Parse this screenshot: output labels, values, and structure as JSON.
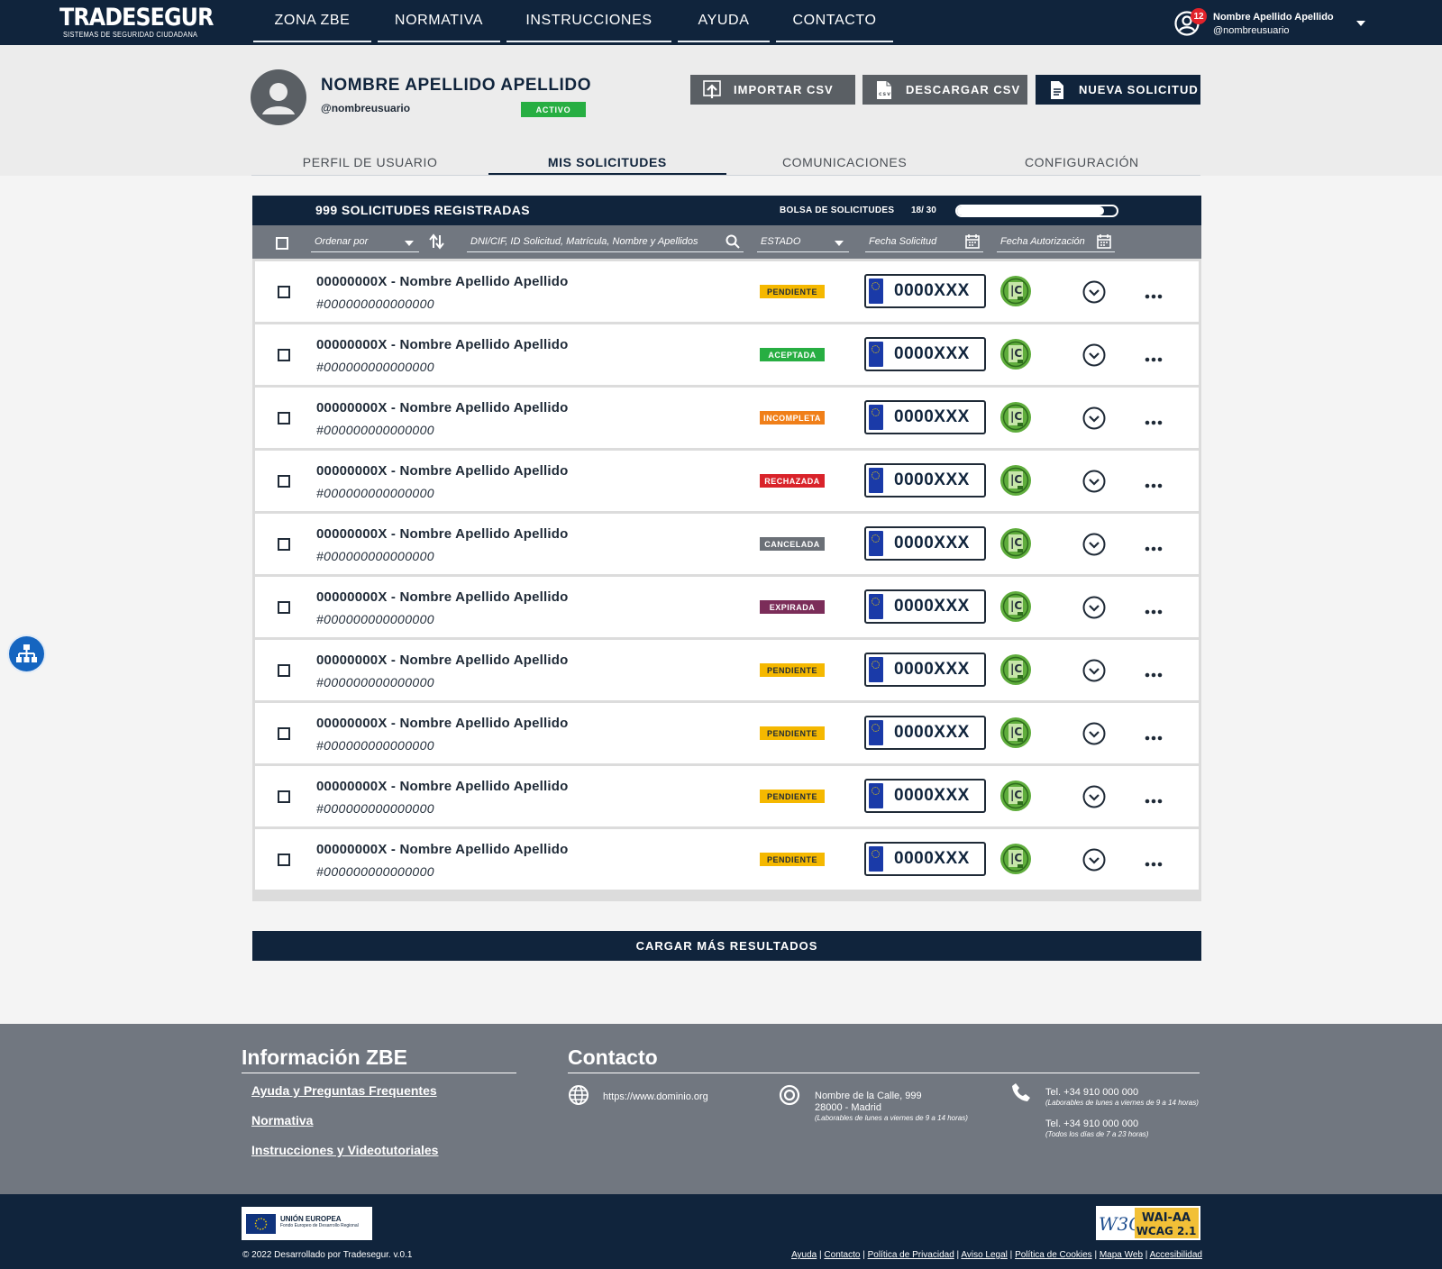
{
  "brand": {
    "name": "TRADESEGUR",
    "tagline": "SISTEMAS DE SEGURIDAD CIUDADANA"
  },
  "nav": {
    "items": [
      {
        "label": "ZONA ZBE",
        "width": 131
      },
      {
        "label": "NORMATIVA",
        "width": 136
      },
      {
        "label": "INSTRUCCIONES",
        "width": 183
      },
      {
        "label": "AYUDA",
        "width": 102
      },
      {
        "label": "CONTACTO",
        "width": 130
      }
    ]
  },
  "user": {
    "name": "Nombre Apellido Apellido",
    "handle": "@nombreusuario",
    "notifications": "12"
  },
  "profile": {
    "name": "NOMBRE APELLIDO APELLIDO",
    "handle": "@nombreusuario",
    "status": "ACTIVO",
    "buttons": {
      "import": "IMPORTAR CSV",
      "download": "DESCARGAR CSV",
      "new": "NUEVA SOLICITUD"
    }
  },
  "tabs": [
    {
      "label": "PERFIL DE USUARIO",
      "active": false
    },
    {
      "label": "MIS SOLICITUDES",
      "active": true
    },
    {
      "label": "COMUNICACIONES",
      "active": false
    },
    {
      "label": "CONFIGURACIÓN",
      "active": false
    }
  ],
  "list": {
    "count": "999 SOLICITUDES REGISTRADAS",
    "bolsa_label": "BOLSA DE SOLICITUDES",
    "bolsa_value": "18/ 30",
    "bolsa_progress": 0.92
  },
  "filters": {
    "order_placeholder": "Ordenar por",
    "search_placeholder": "DNI/CIF, ID Solicitud, Matrícula, Nombre y Apellidos",
    "estado": "ESTADO",
    "fecha_solicitud": "Fecha Solicitud",
    "fecha_autorizacion": "Fecha Autorización"
  },
  "status_colors": {
    "PENDIENTE": {
      "bg": "#f5b800",
      "fg": "#1f2a37"
    },
    "ACEPTADA": {
      "bg": "#27ae42",
      "fg": "#ffffff"
    },
    "INCOMPLETA": {
      "bg": "#f07f19",
      "fg": "#ffffff"
    },
    "RECHAZADA": {
      "bg": "#d9232a",
      "fg": "#ffffff"
    },
    "CANCELADA": {
      "bg": "#6b7077",
      "fg": "#ffffff"
    },
    "EXPIRADA": {
      "bg": "#7b2d59",
      "fg": "#ffffff"
    }
  },
  "rows": [
    {
      "title": "00000000X - Nombre Apellido Apellido",
      "id": "#000000000000000",
      "status": "PENDIENTE",
      "plate": "0000XXX"
    },
    {
      "title": "00000000X - Nombre Apellido Apellido",
      "id": "#000000000000000",
      "status": "ACEPTADA",
      "plate": "0000XXX"
    },
    {
      "title": "00000000X - Nombre Apellido Apellido",
      "id": "#000000000000000",
      "status": "INCOMPLETA",
      "plate": "0000XXX"
    },
    {
      "title": "00000000X - Nombre Apellido Apellido",
      "id": "#000000000000000",
      "status": "RECHAZADA",
      "plate": "0000XXX"
    },
    {
      "title": "00000000X - Nombre Apellido Apellido",
      "id": "#000000000000000",
      "status": "CANCELADA",
      "plate": "0000XXX"
    },
    {
      "title": "00000000X - Nombre Apellido Apellido",
      "id": "#000000000000000",
      "status": "EXPIRADA",
      "plate": "0000XXX"
    },
    {
      "title": "00000000X - Nombre Apellido Apellido",
      "id": "#000000000000000",
      "status": "PENDIENTE",
      "plate": "0000XXX"
    },
    {
      "title": "00000000X - Nombre Apellido Apellido",
      "id": "#000000000000000",
      "status": "PENDIENTE",
      "plate": "0000XXX"
    },
    {
      "title": "00000000X - Nombre Apellido Apellido",
      "id": "#000000000000000",
      "status": "PENDIENTE",
      "plate": "0000XXX"
    },
    {
      "title": "00000000X - Nombre Apellido Apellido",
      "id": "#000000000000000",
      "status": "PENDIENTE",
      "plate": "0000XXX"
    }
  ],
  "load_more": "CARGAR MÁS RESULTADOS",
  "footer": {
    "info_title": "Información ZBE",
    "links": [
      "Ayuda y Preguntas Frequentes",
      "Normativa",
      "Instrucciones y Videotutoriales"
    ],
    "contact_title": "Contacto",
    "web": "https://www.dominio.org",
    "address_line1": "Nombre de la Calle, 999",
    "address_line2": "28000 - Madrid",
    "address_hours": "(Laborables de lunes a viernes de 9 a 14 horas)",
    "phone1": "Tel. +34 910 000 000",
    "phone1_hours": "(Laborables de lunes a viernes de 9 a 14 horas)",
    "phone2": "Tel. +34 910 000 000",
    "phone2_hours": "(Todos los días de 7 a 23 horas)"
  },
  "bottom": {
    "eu_title": "UNIÓN EUROPEA",
    "eu_sub": "Fondo Europeo de Desarrollo Regional",
    "w3c_text1": "WAI-AA",
    "w3c_text2": "WCAG 2.1",
    "copyright": "© 2022 Desarrollado por Tradesegur. v.0.1",
    "legal_links": [
      "Ayuda",
      "Contacto",
      "Política de Privacidad",
      "Aviso Legal",
      "Política de Cookies",
      "Mapa Web",
      "Accesibilidad"
    ]
  }
}
